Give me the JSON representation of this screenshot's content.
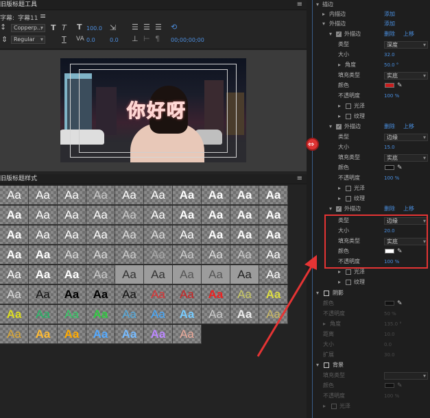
{
  "left": {
    "tools_title": "旧版标题工具",
    "toolbar": {
      "title_label": "字幕:",
      "title_value": "字幕11",
      "font_family": "Copperp...",
      "font_style": "Regular",
      "font_size": "100.0",
      "kerning": "0.0",
      "tracking": "0.0",
      "timecode": "00;00;00;00"
    },
    "video_title": "你好呀",
    "styles_title": "旧版标题样式",
    "swatch_text": "Aa"
  },
  "right": {
    "stroke_section": "描边",
    "inner_stroke": "内描边",
    "outer_stroke": "外描边",
    "add": "添加",
    "delete": "删除",
    "move_up": "上移",
    "type": "类型",
    "size": "大小",
    "angle": "角度",
    "fill_type": "填充类型",
    "color": "颜色",
    "opacity": "不透明度",
    "sheen": "光泽",
    "texture": "纹理",
    "shadow_section": "阴影",
    "distance": "距离",
    "spread": "扩展",
    "background_section": "背景",
    "opt_depth": "深度",
    "opt_edge": "边缘",
    "opt_solid": "实底",
    "stroke1": {
      "size": "32.0",
      "angle": "50.0 °",
      "opacity": "100 %",
      "color": "#c81d1d"
    },
    "stroke2": {
      "size": "15.0",
      "opacity": "100 %",
      "color": "#111111"
    },
    "stroke3": {
      "size": "20.0",
      "opacity": "100 %",
      "color": "#ffffff"
    },
    "shadow": {
      "opacity": "50 %",
      "angle": "135.0 °",
      "distance": "10.0",
      "size": "0.0",
      "spread": "30.0",
      "color": "#111111"
    },
    "background": {
      "opacity": "100 %",
      "color": "#111111"
    }
  }
}
